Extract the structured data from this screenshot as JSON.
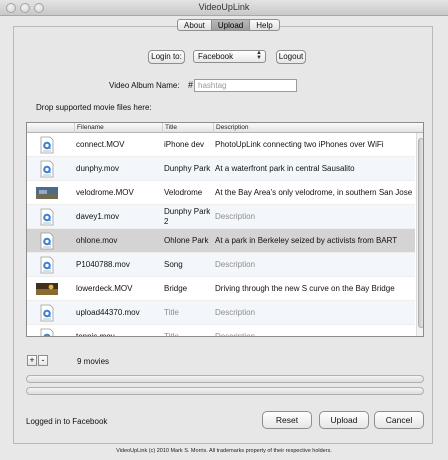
{
  "window": {
    "title": "VideoUpLink"
  },
  "tabs": [
    {
      "label": "About",
      "selected": false
    },
    {
      "label": "Upload",
      "selected": true
    },
    {
      "label": "Help",
      "selected": false
    }
  ],
  "login": {
    "button_label": "Login to:",
    "service_selected": "Facebook",
    "logout_label": "Logout"
  },
  "album": {
    "label": "Video Album Name:",
    "hash_symbol": "#",
    "placeholder": "hashtag"
  },
  "drop_label": "Drop supported movie files here:",
  "table": {
    "columns": [
      "Filename",
      "Title",
      "Description"
    ],
    "rows": [
      {
        "icon": "quicktime-icon",
        "filename": "connect.MOV",
        "title": "iPhone dev",
        "description": "PhotoUpLink connecting two iPhones over WiFi",
        "selected": false
      },
      {
        "icon": "quicktime-icon",
        "filename": "dunphy.mov",
        "title": "Dunphy Park",
        "description": "At a waterfront park in central Sausalito",
        "selected": false
      },
      {
        "icon": "video-thumbnail",
        "filename": "velodrome.MOV",
        "title": "Velodrome",
        "description": "At the Bay Area's only velodrome, in southern San Jose",
        "selected": false
      },
      {
        "icon": "quicktime-icon",
        "filename": "davey1.mov",
        "title": "Dunphy Park 2",
        "description": "Description",
        "selected": false
      },
      {
        "icon": "quicktime-icon",
        "filename": "ohlone.mov",
        "title": "Ohlone Park",
        "description": "At a park in Berkeley seized by activists from BART",
        "selected": true
      },
      {
        "icon": "quicktime-icon",
        "filename": "P1040788.mov",
        "title": "Song",
        "description": "Description",
        "selected": false
      },
      {
        "icon": "video-thumbnail",
        "filename": "lowerdeck.MOV",
        "title": "Bridge",
        "description": "Driving through the new S curve on the Bay Bridge",
        "selected": false
      },
      {
        "icon": "quicktime-icon",
        "filename": "upload44370.mov",
        "title": "Title",
        "description": "Description",
        "selected": false
      },
      {
        "icon": "quicktime-icon",
        "filename": "tennis.mov",
        "title": "Title",
        "description": "Description",
        "selected": false
      }
    ]
  },
  "controls": {
    "add_label": "+",
    "remove_label": "-"
  },
  "movie_count": "9 movies",
  "progress": [
    0,
    0
  ],
  "status_text": "Logged in to Facebook",
  "buttons": {
    "reset": "Reset",
    "upload": "Upload",
    "cancel": "Cancel"
  },
  "footer": "VideoUpLink (c) 2010 Mark S. Morris. All trademarks property of their respective holders.",
  "colors": {
    "selected_row": "#d4d4d4",
    "placeholder_text": "#8c8c8c"
  }
}
